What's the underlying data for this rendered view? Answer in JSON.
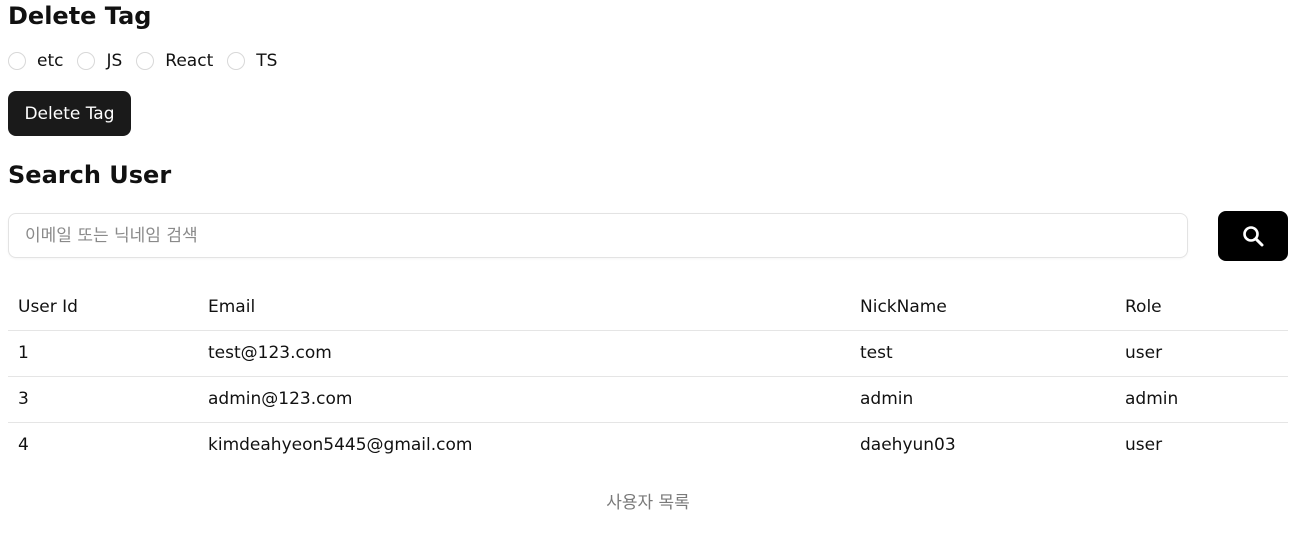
{
  "delete_tag": {
    "title": "Delete Tag",
    "tags": [
      {
        "label": "etc"
      },
      {
        "label": "JS"
      },
      {
        "label": "React"
      },
      {
        "label": "TS"
      }
    ],
    "button_label": "Delete Tag"
  },
  "search_user": {
    "title": "Search User",
    "placeholder": "이메일 또는 닉네임 검색",
    "value": "",
    "search_icon": "search-icon"
  },
  "table": {
    "headers": [
      "User Id",
      "Email",
      "NickName",
      "Role"
    ],
    "rows": [
      [
        "1",
        "test@123.com",
        "test",
        "user"
      ],
      [
        "3",
        "admin@123.com",
        "admin",
        "admin"
      ],
      [
        "4",
        "kimdeahyeon5445@gmail.com",
        "daehyun03",
        "user"
      ]
    ],
    "caption": "사용자 목록"
  },
  "colors": {
    "button_bg": "#1a1a1a",
    "search_button_bg": "#000000",
    "border": "#e5e5e5",
    "caption_text": "#7a7a7a"
  }
}
